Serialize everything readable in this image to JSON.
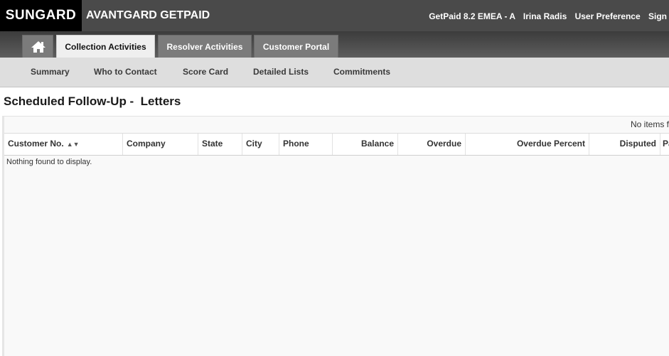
{
  "header": {
    "logo": "SUNGARD",
    "app_title": "AVANTGARD GETPAID",
    "version": "GetPaid 8.2 EMEA - A",
    "user": "Irina Radis",
    "user_preference": "User Preference",
    "sign": "Sign"
  },
  "tabs": {
    "collection": "Collection Activities",
    "resolver": "Resolver Activities",
    "customer_portal": "Customer Portal"
  },
  "subnav": {
    "summary": "Summary",
    "who_to_contact": "Who to Contact",
    "score_card": "Score Card",
    "detailed_lists": "Detailed Lists",
    "commitments": "Commitments"
  },
  "page": {
    "title": "Scheduled Follow-Up -  Letters"
  },
  "grid": {
    "pager_text": "No items f",
    "columns": {
      "customer_no": "Customer No.",
      "company": "Company",
      "state": "State",
      "city": "City",
      "phone": "Phone",
      "balance": "Balance",
      "overdue": "Overdue",
      "overdue_percent": "Overdue Percent",
      "disputed": "Disputed",
      "pa": "Pa"
    },
    "empty_message": "Nothing found to display."
  }
}
